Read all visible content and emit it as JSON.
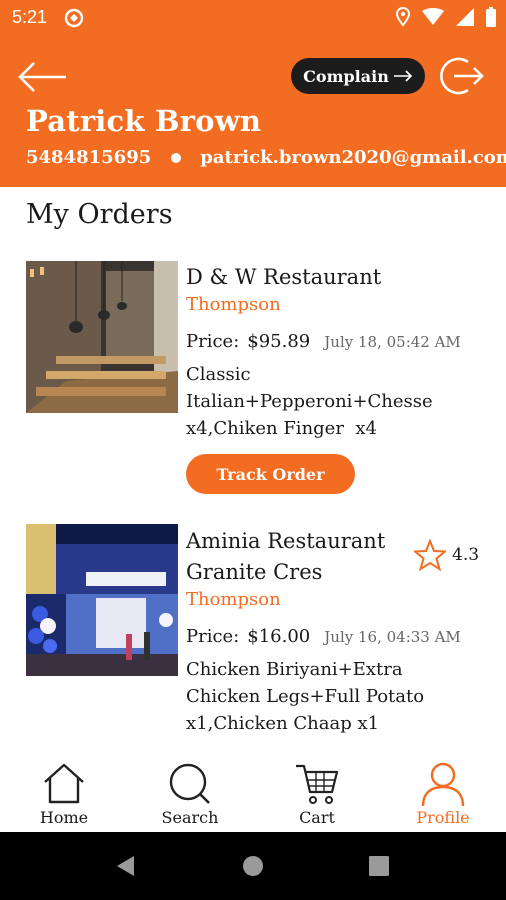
{
  "status_bar": {
    "time": "5:21"
  },
  "header": {
    "complain_label": "Complain",
    "user_name": "Patrick Brown",
    "phone": "5484815695",
    "email": "patrick.brown2020@gmail.com"
  },
  "section_title": "My Orders",
  "orders": [
    {
      "restaurant": "D & W Restaurant",
      "location": "Thompson",
      "price_label": "Price:",
      "price": "$95.89",
      "date": "July 18, 05:42 AM",
      "items_lines": [
        "Classic",
        "Italian+Pepperoni+Chesse",
        "x4,Chiken Finger  x4"
      ],
      "track_label": "Track Order"
    },
    {
      "restaurant_lines": [
        "Aminia Restaurant",
        "Granite Cres"
      ],
      "rating": "4.3",
      "location": "Thompson",
      "price_label": "Price:",
      "price": "$16.00",
      "date": "July 16, 04:33 AM",
      "items_lines": [
        "Chicken Biriyani+Extra",
        "Chicken Legs+Full Potato",
        "x1,Chicken Chaap x1"
      ]
    }
  ],
  "bottom_nav": [
    {
      "label": "Home",
      "icon": "home-icon"
    },
    {
      "label": "Search",
      "icon": "search-icon"
    },
    {
      "label": "Cart",
      "icon": "cart-icon"
    },
    {
      "label": "Profile",
      "icon": "profile-icon",
      "active": true
    }
  ],
  "colors": {
    "accent": "#f26d21",
    "dark": "#1c1c1c"
  }
}
